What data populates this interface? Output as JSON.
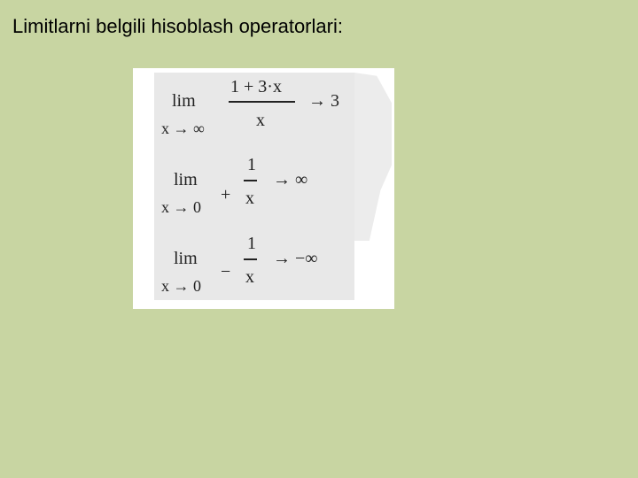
{
  "slide": {
    "title": "Limitlarni belgili hisoblash operatorlari:"
  },
  "formulas": [
    {
      "lim": "lim",
      "sub": "x → ∞",
      "sign": "",
      "numerator": "1 + 3·x",
      "denominator": "x",
      "result": "→ 3"
    },
    {
      "lim": "lim",
      "sub": "x → 0",
      "sign": "+",
      "numerator": "1",
      "denominator": "x",
      "result": "→ ∞"
    },
    {
      "lim": "lim",
      "sub": "x → 0",
      "sign": "−",
      "numerator": "1",
      "denominator": "x",
      "result": "→ −∞"
    }
  ]
}
